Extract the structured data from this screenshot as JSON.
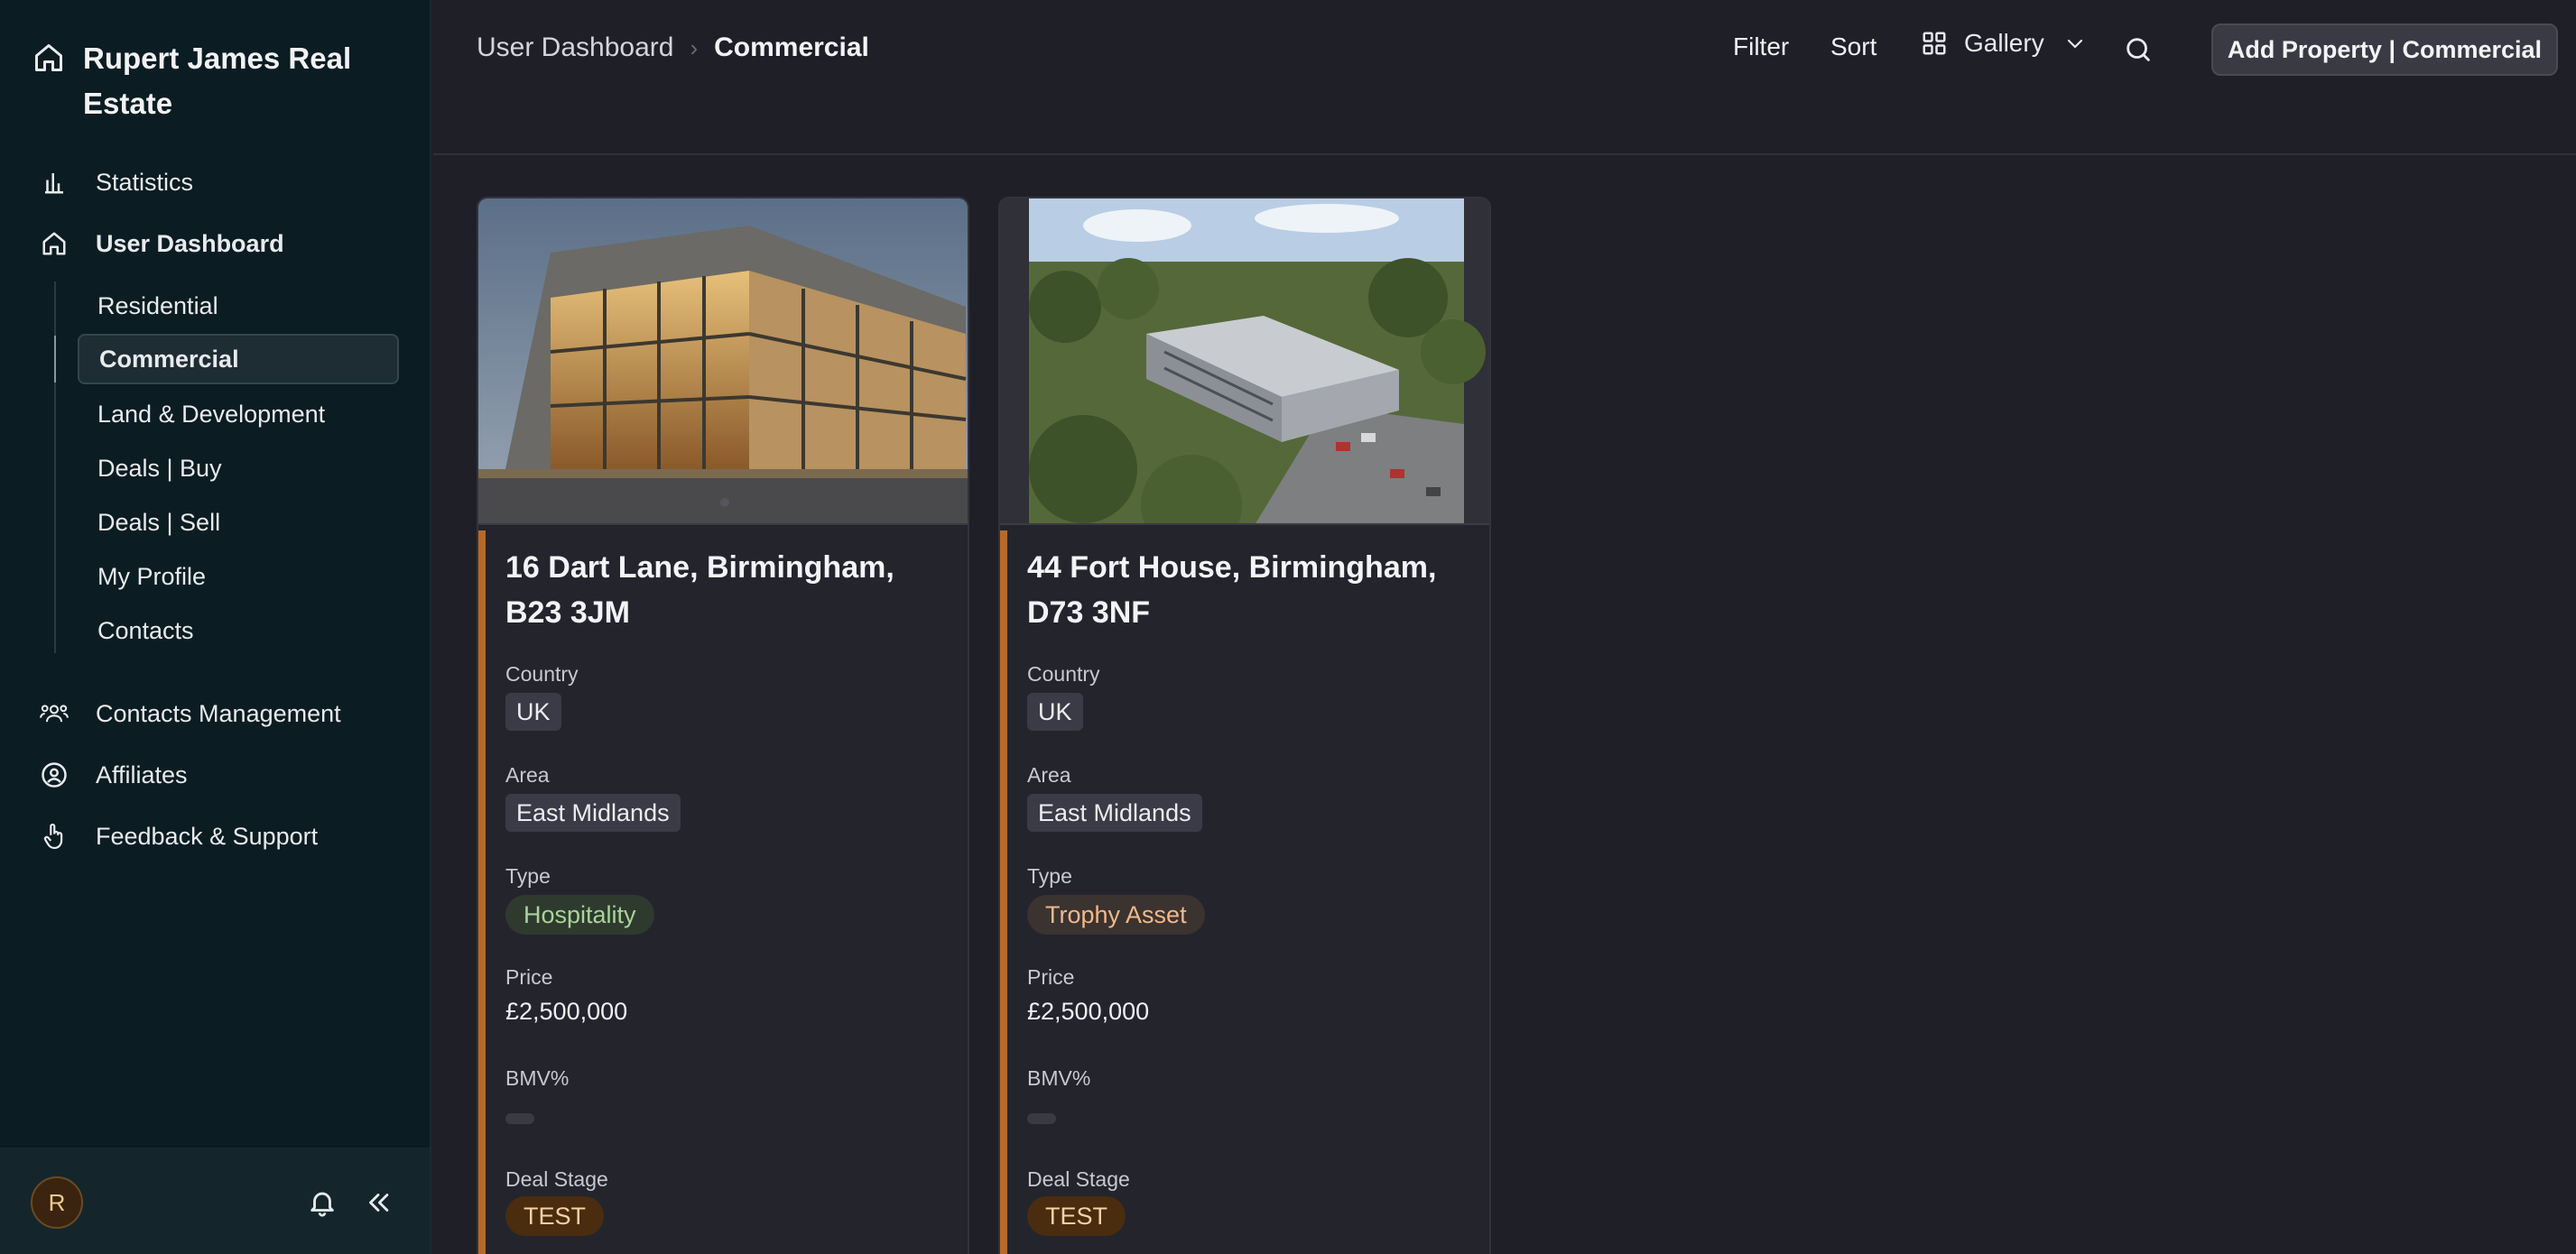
{
  "brand": {
    "title": "Rupert James Real Estate"
  },
  "nav": {
    "statistics": "Statistics",
    "user_dashboard": "User Dashboard",
    "sub_items": [
      "Residential",
      "Commercial",
      "Land & Development",
      "Deals | Buy",
      "Deals | Sell",
      "My Profile",
      "Contacts"
    ],
    "contacts_management": "Contacts Management",
    "affiliates": "Affiliates",
    "feedback_support": "Feedback & Support"
  },
  "footer": {
    "avatar_initial": "R"
  },
  "breadcrumb": {
    "parent": "User Dashboard",
    "current": "Commercial"
  },
  "toolbar": {
    "filter": "Filter",
    "sort": "Sort",
    "view": "Gallery",
    "add_button": "Add Property | Commercial"
  },
  "labels": {
    "country": "Country",
    "area": "Area",
    "type": "Type",
    "price": "Price",
    "bmv": "BMV%",
    "deal_stage": "Deal Stage"
  },
  "cards": [
    {
      "title": "16 Dart Lane, Birmingham, B23 3JM",
      "country": "UK",
      "area": "East Midlands",
      "type": "Hospitality",
      "price": "£2,500,000",
      "deal_stage": "TEST"
    },
    {
      "title": "44 Fort House, Birmingham, D73 3NF",
      "country": "UK",
      "area": "East Midlands",
      "type": "Trophy Asset",
      "price": "£2,500,000",
      "deal_stage": "TEST"
    }
  ],
  "colors": {
    "accent": "#b8692a",
    "hospitality_text": "#a9d49a",
    "hospitality_bg": "#2e3a2e",
    "trophy_text": "#f0b88a",
    "trophy_bg": "#3a3330",
    "stage_bg": "#4a2c0e",
    "stage_text": "#f6d2a4"
  }
}
